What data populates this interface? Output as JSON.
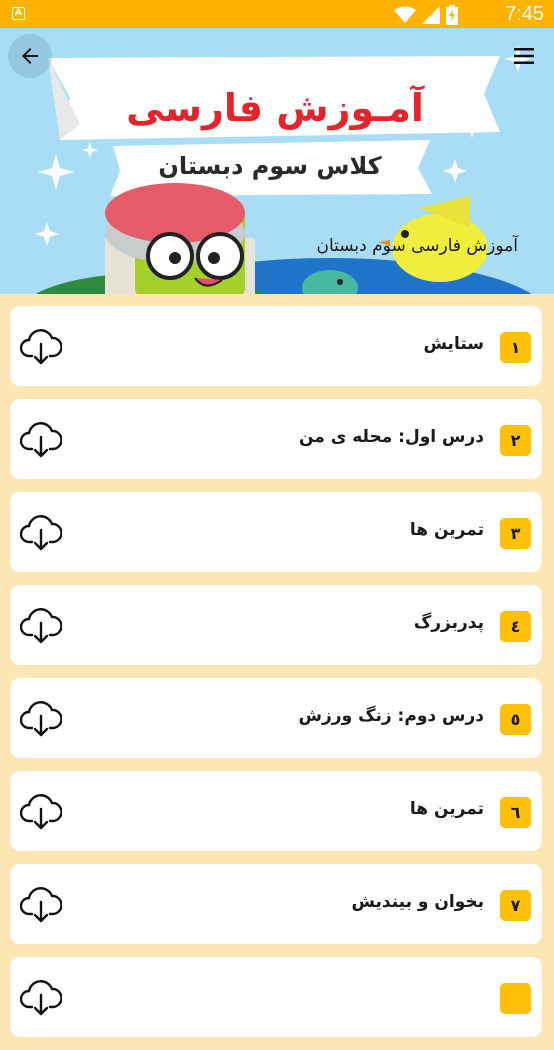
{
  "status_bar": {
    "time": "7:45",
    "app_icon_letter": "A",
    "icons": [
      "wifi-icon",
      "signal-icon",
      "battery-charging-icon"
    ]
  },
  "toolbar": {
    "back_icon": "arrow-back-icon",
    "menu_icon": "hamburger-menu-icon"
  },
  "banner": {
    "heading": "آمـوزش فارسی",
    "subheading": "کلاس سوم دبستان",
    "caption": "آموزش فارسی سوم دبستان"
  },
  "lessons": [
    {
      "number": "۱",
      "title": "ستایش"
    },
    {
      "number": "۲",
      "title": "درس اول: محله ی من"
    },
    {
      "number": "۳",
      "title": "تمرین ها"
    },
    {
      "number": "٤",
      "title": "پدربزرگ"
    },
    {
      "number": "٥",
      "title": "درس دوم: زنگ ورزش"
    },
    {
      "number": "٦",
      "title": "تمرین ها"
    },
    {
      "number": "۷",
      "title": "بخوان و بیندیش"
    }
  ],
  "colors": {
    "status_bar": "#FFB300",
    "background": "#FCE6B4",
    "badge": "#FFC107",
    "heading_red": "#E5232B",
    "banner_sky": "#A8DDF5"
  }
}
